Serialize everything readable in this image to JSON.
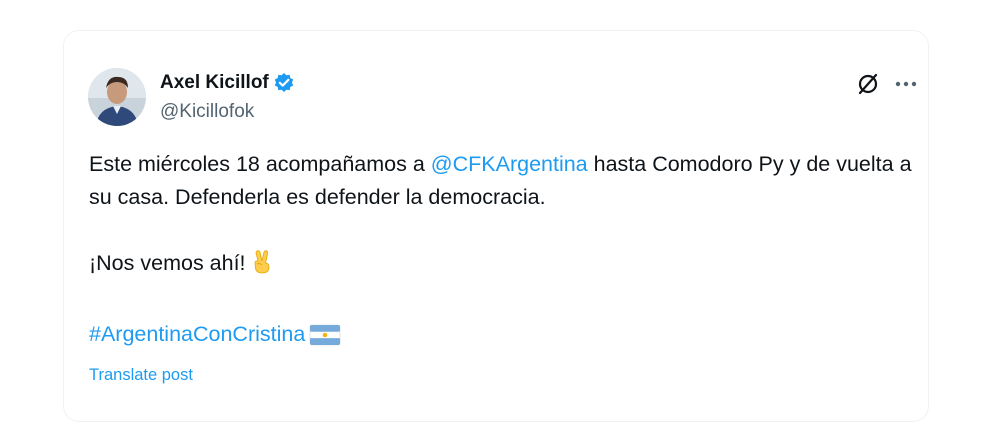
{
  "author": {
    "display_name": "Axel Kicillof",
    "handle": "@Kicillofok",
    "verified": true
  },
  "icons": {
    "avatar": "profile-photo",
    "verified": "verified-badge-icon",
    "grok": "grok-icon",
    "more": "more-options-icon",
    "victory_hand": "victory-hand-emoji",
    "flag": "argentina-flag-emoji"
  },
  "colors": {
    "link": "#1d9bf0",
    "text": "#0f1419",
    "secondary": "#536471"
  },
  "tweet": {
    "line1_pre": "Este miércoles 18 acompañamos a ",
    "mention": "@CFKArgentina",
    "line1_post": " hasta Comodoro Py y de vuelta a su casa. Defenderla es defender la democracia.",
    "line2": "¡Nos vemos ahí!",
    "hashtag": "#ArgentinaConCristina"
  },
  "translate_label": "Translate post"
}
